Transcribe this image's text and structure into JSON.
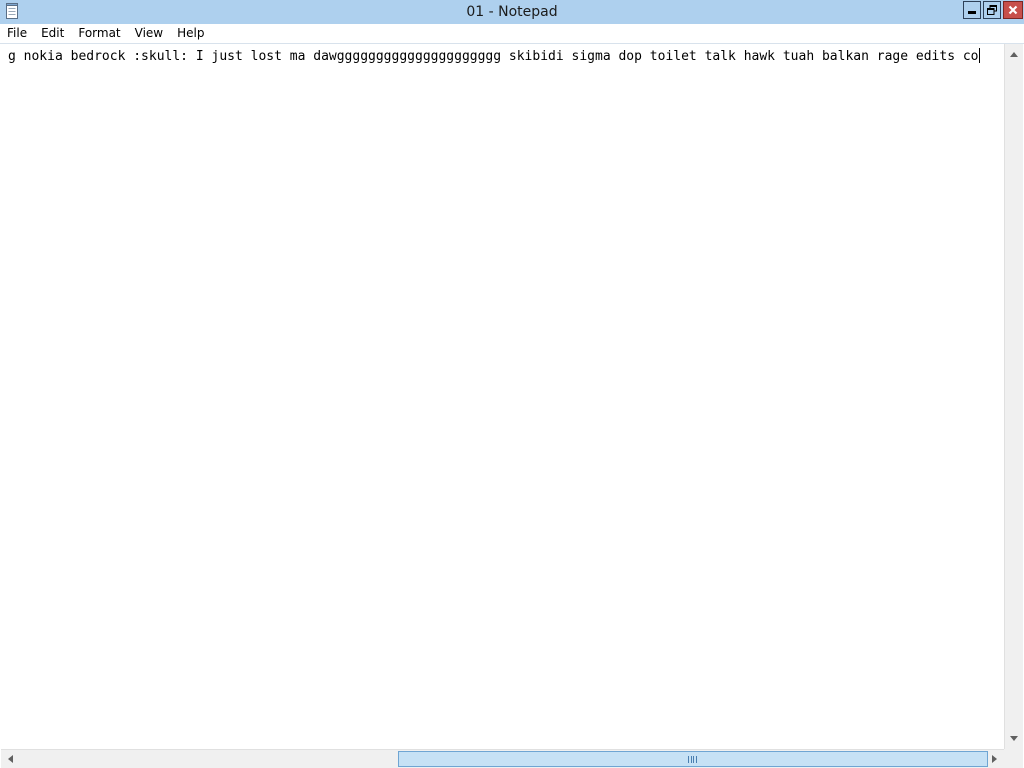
{
  "window": {
    "title": "01 - Notepad",
    "app_icon": "notepad-icon",
    "caption_buttons": [
      "minimize-icon",
      "restore-icon",
      "close-icon"
    ]
  },
  "menu": {
    "items": [
      {
        "label": "File"
      },
      {
        "label": "Edit"
      },
      {
        "label": "Format"
      },
      {
        "label": "View"
      },
      {
        "label": "Help"
      }
    ]
  },
  "editor": {
    "text": "g nokia bedrock :skull: I just lost ma dawggggggggggggggggggggg skibidi sigma dop toilet talk hawk tuah balkan rage edits co"
  },
  "scrollbars": {
    "horizontal_thumb_position": 0.4,
    "horizontal_thumb_fraction": 0.6
  },
  "colors": {
    "titlebar": "#aed0ee",
    "close_button": "#c7504b",
    "scroll_thumb": "#c6e1f5"
  }
}
